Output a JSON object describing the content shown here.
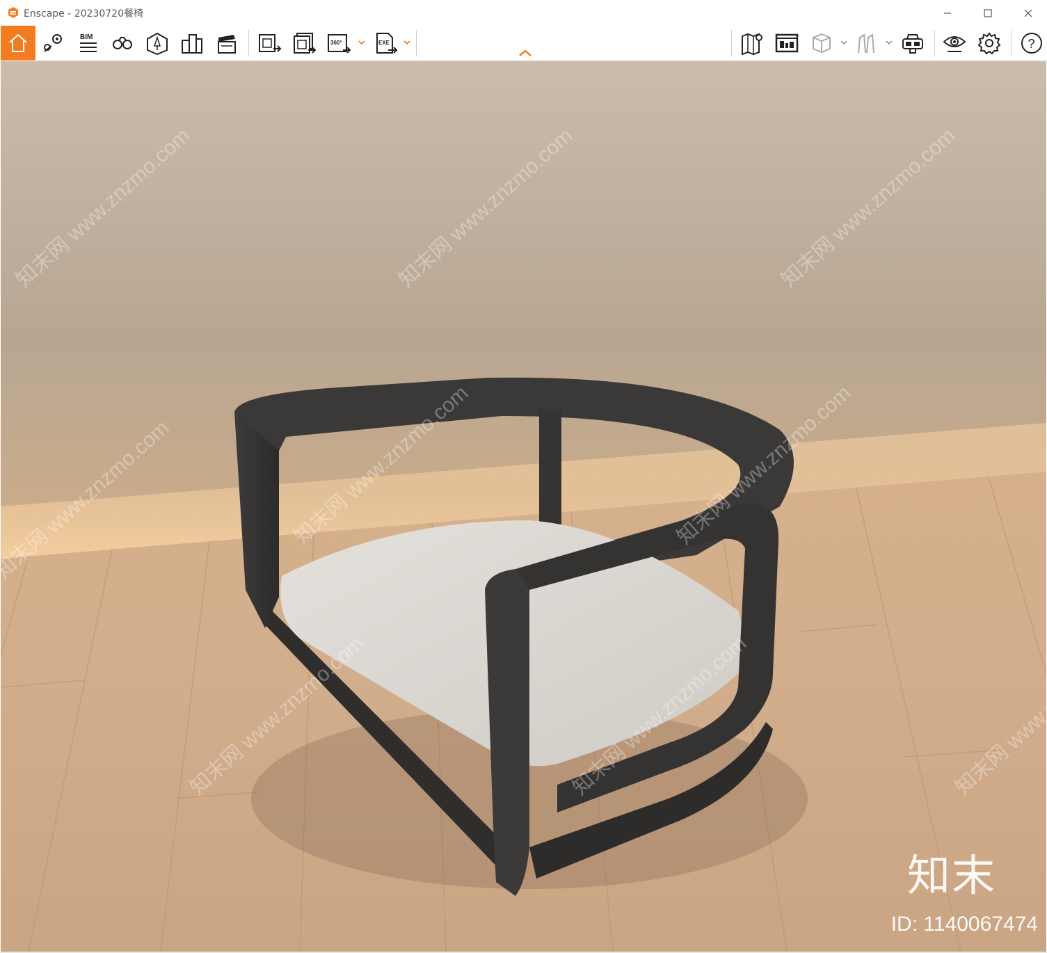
{
  "window": {
    "title": "Enscape - 20230720餐椅",
    "accent_color": "#f47c20"
  },
  "toolbar": {
    "left_tools": [
      {
        "name": "home-icon",
        "active": true
      },
      {
        "name": "location-pin-icon"
      },
      {
        "name": "bim-icon",
        "label": "BIM"
      },
      {
        "name": "binoculars-icon"
      },
      {
        "name": "asset-library-icon"
      },
      {
        "name": "buildings-icon"
      },
      {
        "name": "clapperboard-icon"
      }
    ],
    "export_tools": [
      {
        "name": "render-screenshot-icon"
      },
      {
        "name": "batch-render-icon"
      },
      {
        "name": "panorama-360-icon",
        "label": "360°",
        "has_dropdown": true
      },
      {
        "name": "exe-export-icon",
        "label": "EXE",
        "has_dropdown": true
      }
    ],
    "right_tools": [
      {
        "name": "map-icon"
      },
      {
        "name": "minimap-icon"
      },
      {
        "name": "cube-view-icon",
        "has_dropdown": true
      },
      {
        "name": "vr-figures-icon",
        "has_dropdown": true
      },
      {
        "name": "vr-headset-icon"
      },
      {
        "name": "visual-settings-eye-icon"
      },
      {
        "name": "settings-gear-icon"
      },
      {
        "name": "help-icon",
        "label": "?"
      }
    ]
  },
  "viewport": {
    "scene": "floor-chair-render",
    "watermark_text": "知末网 www.znzmo.com",
    "watermark_logo": "知末",
    "watermark_id": "ID: 1140067474"
  }
}
